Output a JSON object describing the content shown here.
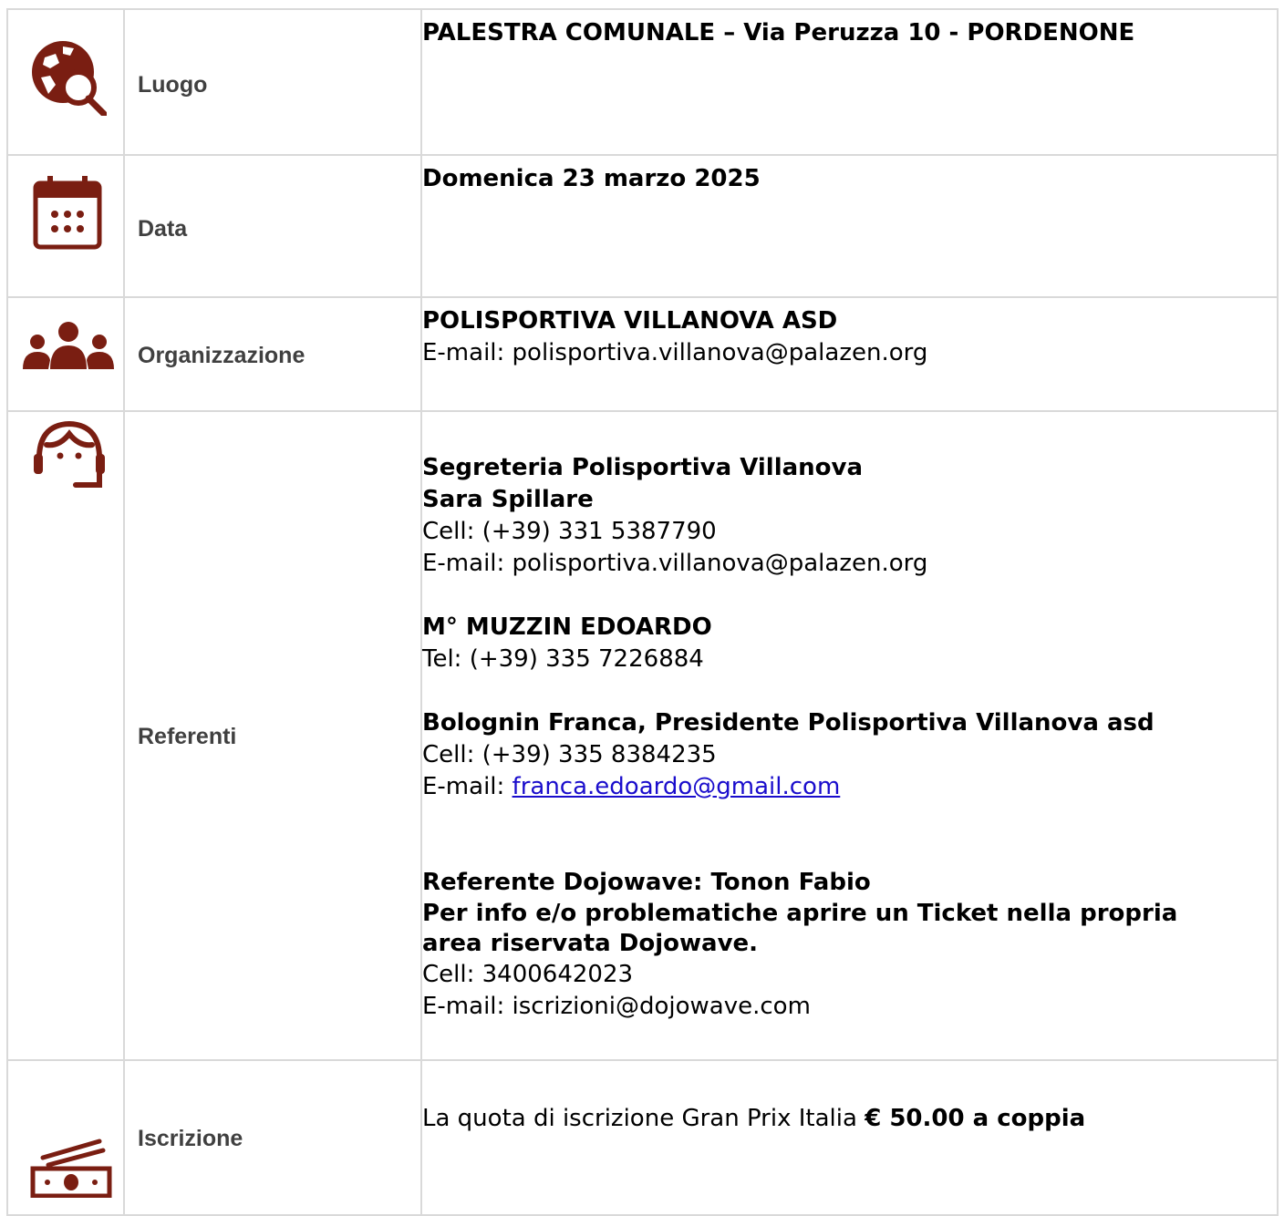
{
  "rows": {
    "luogo": {
      "icon": "globe-search-icon",
      "label": "Luogo",
      "value": "PALESTRA COMUNALE  – Via Peruzza 10 - PORDENONE"
    },
    "data": {
      "icon": "calendar-icon",
      "label": "Data",
      "value": "Domenica 23  marzo 2025"
    },
    "organizzazione": {
      "icon": "group-icon",
      "label": "Organizzazione",
      "name": "POLISPORTIVA VILLANOVA ASD",
      "email": "E-mail: polisportiva.villanova@palazen.org"
    },
    "referenti": {
      "icon": "headset-person-icon",
      "label": "Referenti",
      "segreteria": {
        "title": "Segreteria Polisportiva Villanova",
        "name": "Sara Spillare",
        "cell": "Cell: (+39) 331 5387790",
        "email": "E-mail: polisportiva.villanova@palazen.org"
      },
      "maestro": {
        "name": "M° MUZZIN EDOARDO",
        "tel": "Tel: (+39) 335 7226884"
      },
      "presidente": {
        "name": "Bolognin Franca, Presidente Polisportiva Villanova asd",
        "cell": "Cell: (+39) 335 8384235",
        "email_prefix": "E-mail: ",
        "email_link": "franca.edoardo@gmail.com"
      },
      "dojowave": {
        "title": "Referente Dojowave: Tonon Fabio",
        "note_line1": "Per info e/o problematiche aprire un Ticket nella propria",
        "note_line2": "area riservata Dojowave.",
        "cell": "Cell: 3400642023",
        "email": "E-mail: iscrizioni@dojowave.com"
      }
    },
    "iscrizione": {
      "icon": "money-icon",
      "label": "Iscrizione",
      "text": "La quota di iscrizione Gran Prix Italia ",
      "amount": "€ 50.00 a coppia"
    }
  },
  "colors": {
    "icon": "#7a1e12",
    "label": "#404040",
    "border": "#d9d9d9",
    "link": "#1a0dcc"
  }
}
